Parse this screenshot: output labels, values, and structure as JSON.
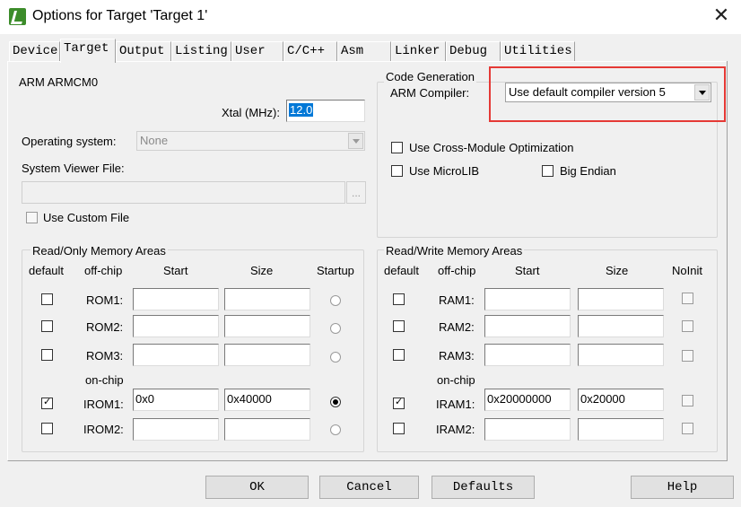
{
  "window": {
    "title": "Options for Target 'Target 1'"
  },
  "tabs": [
    {
      "label": "Device"
    },
    {
      "label": "Target"
    },
    {
      "label": "Output"
    },
    {
      "label": "Listing"
    },
    {
      "label": "User"
    },
    {
      "label": "C/C++"
    },
    {
      "label": "Asm"
    },
    {
      "label": "Linker"
    },
    {
      "label": "Debug"
    },
    {
      "label": "Utilities"
    }
  ],
  "target": {
    "device_name": "ARM ARMCM0",
    "xtal_label": "Xtal (MHz):",
    "xtal_value": "12.0",
    "os_label": "Operating system:",
    "os_value": "None",
    "sysviewer_label": "System Viewer File:",
    "sysviewer_value": "",
    "browse_label": "...",
    "use_custom_file_label": "Use Custom File"
  },
  "code_generation": {
    "title": "Code Generation",
    "arm_compiler_label": "ARM Compiler:",
    "arm_compiler_value": "Use default compiler version 5",
    "cross_module_label": "Use Cross-Module Optimization",
    "microlib_label": "Use MicroLIB",
    "big_endian_label": "Big Endian"
  },
  "rom_area": {
    "title": "Read/Only Memory Areas",
    "headers": {
      "default": "default",
      "offchip": "off-chip",
      "start": "Start",
      "size": "Size",
      "last": "Startup"
    },
    "onchip_label": "on-chip",
    "rows": [
      {
        "name": "ROM1:",
        "start": "",
        "size": "",
        "default": false,
        "selected": false
      },
      {
        "name": "ROM2:",
        "start": "",
        "size": "",
        "default": false,
        "selected": false
      },
      {
        "name": "ROM3:",
        "start": "",
        "size": "",
        "default": false,
        "selected": false
      },
      {
        "name": "IROM1:",
        "start": "0x0",
        "size": "0x40000",
        "default": true,
        "selected": true
      },
      {
        "name": "IROM2:",
        "start": "",
        "size": "",
        "default": false,
        "selected": false
      }
    ]
  },
  "ram_area": {
    "title": "Read/Write Memory Areas",
    "headers": {
      "default": "default",
      "offchip": "off-chip",
      "start": "Start",
      "size": "Size",
      "last": "NoInit"
    },
    "onchip_label": "on-chip",
    "rows": [
      {
        "name": "RAM1:",
        "start": "",
        "size": "",
        "default": false,
        "noinit": false
      },
      {
        "name": "RAM2:",
        "start": "",
        "size": "",
        "default": false,
        "noinit": false
      },
      {
        "name": "RAM3:",
        "start": "",
        "size": "",
        "default": false,
        "noinit": false
      },
      {
        "name": "IRAM1:",
        "start": "0x20000000",
        "size": "0x20000",
        "default": true,
        "noinit": false
      },
      {
        "name": "IRAM2:",
        "start": "",
        "size": "",
        "default": false,
        "noinit": false
      }
    ]
  },
  "buttons": {
    "ok": "OK",
    "cancel": "Cancel",
    "defaults": "Defaults",
    "help": "Help"
  },
  "colors": {
    "highlight_border": "#e53935",
    "selection": "#0078d7"
  }
}
